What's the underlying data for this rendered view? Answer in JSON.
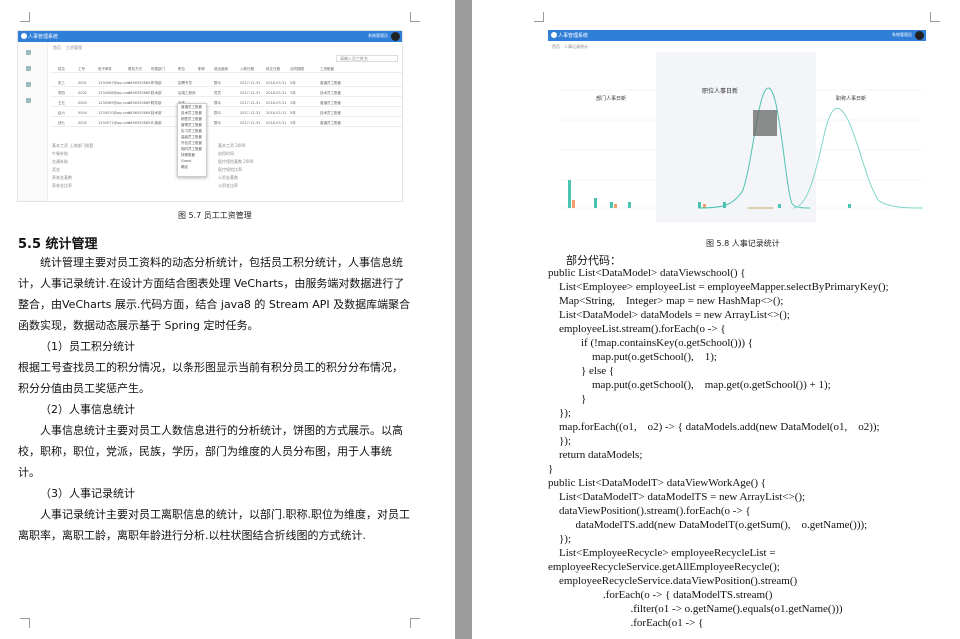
{
  "left_page": {
    "figure_57": {
      "app_title": "人事管理系统",
      "user": "系统管理员",
      "breadcrumb": [
        "首页",
        "工资管理"
      ],
      "search_placeholder": "请输入员工姓名",
      "columns": [
        "姓名",
        "工号",
        "电子邮件",
        "联系方式",
        "所属部门",
        "职位",
        "职称",
        "政治面貌",
        "入职日期",
        "转正日期",
        "合同期限",
        "工资账套"
      ],
      "rows": [
        [
          "张三",
          "0001",
          "1234567@qq.com",
          "18565558897",
          "市场部",
          "招聘专员",
          "",
          "群众",
          "2017-12-31",
          "2018-03-31",
          "5年",
          "普通员工账套"
        ],
        [
          "李四",
          "0002",
          "1234568@qq.com",
          "18565558897",
          "技术部",
          "后端工程师",
          "",
          "党员",
          "2017-12-31",
          "2018-03-31",
          "3年",
          "技术员工账套"
        ],
        [
          "王五",
          "0003",
          "1234569@qq.com",
          "18565558897",
          "财务部",
          "出纳",
          "",
          "群众",
          "2017-12-31",
          "2018-03-31",
          "3年",
          "普通员工账套"
        ],
        [
          "赵六",
          "0004",
          "1234570@qq.com",
          "18565558897",
          "技术部",
          "前端工程师",
          "",
          "群众",
          "2017-12-31",
          "2018-03-31",
          "5年",
          "技术员工账套"
        ],
        [
          "钱七",
          "0005",
          "1234571@qq.com",
          "18565558897",
          "人事部",
          "人事专员",
          "",
          "群众",
          "2017-12-31",
          "2018-03-31",
          "3年",
          "普通员工账套"
        ]
      ],
      "menu_items": [
        "普通员工账套",
        "技术员工账套",
        "销售员工账套",
        "管理员工账套",
        "实习员工账套",
        "高级员工账套",
        "外包员工账套",
        "临时员工账套",
        "特殊账套",
        "Guest",
        "确定"
      ],
      "detail_labels_left": [
        "基本工资",
        "午餐补助",
        "交通补助",
        "奖金",
        "养老金基数",
        "养老金比率"
      ],
      "detail_values_left": [
        "上海部门账套",
        "",
        "",
        "",
        "",
        ""
      ],
      "detail_labels_right": [
        "基本工资",
        "启用时间",
        "医疗保险基数",
        "医疗保险比率",
        "公积金基数",
        "公积金比率"
      ],
      "detail_values_right": [
        "2000",
        "",
        "2000",
        "",
        "",
        ""
      ],
      "caption": "图 5.7   员工工资管理"
    },
    "section_title": "5.5 统计管理",
    "paragraphs": [
      {
        "indent": true,
        "text": "统计管理主要对员工资料的动态分析统计，包括员工积分统计，人事信息统计，人事记录统计.在设计方面结合图表处理 VeCharts，由服务端对数据进行了整合，由VeCharts 展示.代码方面，结合 java8 的 Stream API 及数据库端聚合函数实现，数据动态展示基于 Spring 定时任务。"
      },
      {
        "indent": true,
        "text": "（1）员工积分统计"
      },
      {
        "indent": false,
        "text": "根据工号查找员工的积分情况，以条形图显示当前有积分员工的积分分布情况，积分分值由员工奖惩产生。"
      },
      {
        "indent": true,
        "text": "（2）人事信息统计"
      },
      {
        "indent": true,
        "text": "人事信息统计主要对员工人数信息进行的分析统计，饼图的方式展示。以高校，职称，职位，党派，民族，学历，部门为维度的人员分布图，用于人事统计。"
      },
      {
        "indent": true,
        "text": "（3）人事记录统计"
      },
      {
        "indent": true,
        "text": "人事记录统计主要对员工离职信息的统计，以部门.职称.职位为维度，对员工离职率，离职工龄，离职年龄进行分析.以柱状图结合折线图的方式统计."
      }
    ]
  },
  "right_page": {
    "figure_58": {
      "app_title": "人事管理系统",
      "user": "系统管理员",
      "breadcrumb": [
        "首页",
        "人事记录统计"
      ],
      "chart_titles": [
        "部门人事日新",
        "职位人事日新",
        "职称人事日新"
      ],
      "caption": "图 5.8   人事记录统计"
    },
    "code_intro": "部分代码：",
    "code_lines": [
      "public List<DataModel> dataViewschool() {",
      "    List<Employee> employeeList = employeeMapper.selectByPrimaryKey();",
      "    Map<String,    Integer> map = new HashMap<>();",
      "    List<DataModel> dataModels = new ArrayList<>();",
      "    employeeList.stream().forEach(o -> {",
      "            if (!map.containsKey(o.getSchool())) {",
      "                map.put(o.getSchool(),    1);",
      "            } else {",
      "                map.put(o.getSchool(),    map.get(o.getSchool()) + 1);",
      "            }",
      "    });",
      "    map.forEach((o1,    o2) -> { dataModels.add(new DataModel(o1,    o2));",
      "    });",
      "    return dataModels;",
      "}",
      "public List<DataModelT> dataViewWorkAge() {",
      "    List<DataModelT> dataModelTS = new ArrayList<>();",
      "    dataViewPosition().stream().forEach(o -> {",
      "          dataModelTS.add(new DataModelT(o.getSum(),    o.getName()));",
      "    });",
      "    List<EmployeeRecycle> employeeRecycleList =",
      "employeeRecycleService.getAllEmployeeRecycle();",
      "    employeeRecycleService.dataViewPosition().stream()",
      "                    .forEach(o -> { dataModelTS.stream()",
      "                              .filter(o1 -> o.getName().equals(o1.getName()))",
      "                              .forEach(o1 -> {"
    ]
  },
  "colors": {
    "app_blue": "#2f7ed8",
    "chart_teal": "#4cc2b0"
  }
}
